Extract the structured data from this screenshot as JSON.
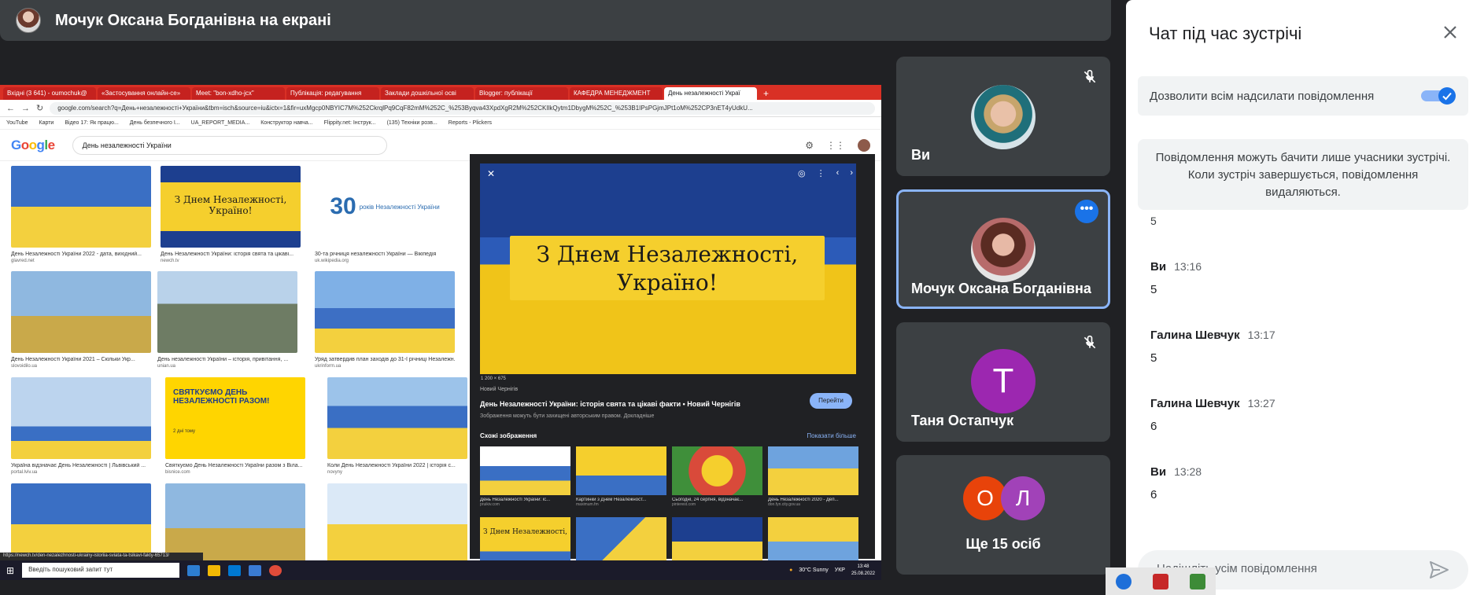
{
  "presenter": {
    "title": "Мочук Оксана Богданівна на екрані"
  },
  "screen": {
    "tabs": [
      "Вхідні (3 641) - oumochuk@",
      "«Застосування онлайн-се»",
      "Meet: \"bon-xdho-jcx\"",
      "Публікація: редагування",
      "Заклади дошкільної осві",
      "Blogger: публікації",
      "КАФЕДРА МЕНЕДЖМЕНТ",
      "День незалежності Украї"
    ],
    "url": "google.com/search?q=День+незалежності+України&tbm=isch&source=iu&ictx=1&fir=uxMgcp0NBYIC7M%252CkrqlPq9CqF82mM%252C_%253Byqva43XpdXgR2M%252CKIlkQytm1DbygM%252C_%253B1IPsPGjmJPt1oM%252CP3nET4yUdkU...",
    "bookmarks": [
      "YouTube",
      "Карти",
      "Відео 17: Як працю...",
      "День безпечного І...",
      "UA_REPORT_MEDIA...",
      "Конструктор навча...",
      "Flippity.net: Інструк...",
      "(135) Техніки розв...",
      "Reports - Plickers"
    ],
    "search_query": "День незалежності України",
    "results": [
      {
        "caption": "День Незалежності України 2022 - дата, вихідний...",
        "source": "glavred.net"
      },
      {
        "caption": "День Незалежності України: історія свята та цікаві...",
        "source": "newch.tv",
        "image_text": "З Днем Незалежності, Україно!"
      },
      {
        "caption": "30-та річниця незалежності України — Вікіпедія",
        "source": "uk.wikipedia.org",
        "logo_number": "30",
        "logo_text": "років Незалежності України"
      },
      {
        "caption": "День Незалежності України 2021 – Скільки Укр...",
        "source": "slovoidilo.ua"
      },
      {
        "caption": "День незалежності України – історія, привітання, ...",
        "source": "unian.ua"
      },
      {
        "caption": "Уряд затвердив план заходів до 31-ї річниці Незалежн...",
        "source": "ukrinform.ua"
      },
      {
        "caption": "Україна відзначає День Незалежності | Львівський ...",
        "source": "portal.lviv.ua"
      },
      {
        "caption": "Святкуємо День Незалежності України разом з Віла...",
        "source": "bisnice.com",
        "image_text": "СВЯТКУЄМО ДЕНЬ НЕЗАЛЕЖНОСТІ РАЗОМ!",
        "badge": "2 дні тому"
      },
      {
        "caption": "Коли День Незалежності України 2022 | історія с...",
        "source": "novyny"
      }
    ],
    "preview": {
      "banner_line1": "З Днем Незалежності,",
      "banner_line2": "Україно!",
      "dimensions": "1 200 × 675",
      "source": "Новий Чернігів",
      "title": "День Незалежності України: історія свята та цікаві факти • Новий Чернігів",
      "note": "Зображення можуть бути захищені авторським правом. Докладніше",
      "visit": "Перейти",
      "similar": "Схожі зображення",
      "show_more": "Показати більше",
      "thumbs": [
        {
          "caption": "День Незалежності України: іс...",
          "source": "pruikiv.com"
        },
        {
          "caption": "Картинки з Днем Незалежност...",
          "source": "maximum.fm"
        },
        {
          "caption": "Сьогодні, 24 серпня, відзначає...",
          "source": "pinterest.com"
        },
        {
          "caption": "День Незалежності 2020 - Деп...",
          "source": "don.fyn.city.gov.ua"
        }
      ],
      "thumb_text": "З Днем Незалежності,"
    },
    "status_url": "https://newch.tv/den-nezalezhnosti-ukrainy-istoriia-sviata-ta-tsikavi-fakty-65713/",
    "taskbar": {
      "search": "Введіть пошуковий запит тут",
      "weather": "30°C Sunny",
      "lang": "УКР",
      "time": "13:48",
      "date": "25.08.2022"
    }
  },
  "tiles": [
    {
      "name": "Ви"
    },
    {
      "name": "Мочук Оксана Богданівна"
    },
    {
      "name": "Таня Остапчук",
      "initial": "T"
    },
    {
      "initials": [
        "О",
        "Л"
      ],
      "label": "Ще 15 осіб"
    }
  ],
  "chat": {
    "title": "Чат під час зустрічі",
    "allow_label": "Дозволити всім надсилати повідомлення",
    "notice": "Повідомлення можуть бачити лише учасники зустрічі. Коли зустріч завершується, повідомлення видаляються.",
    "stray": "5",
    "messages": [
      {
        "sender": "Ви",
        "time": "13:16",
        "text": "5"
      },
      {
        "sender": "Галина Шевчук",
        "time": "13:17",
        "text": "5"
      },
      {
        "sender": "Галина Шевчук",
        "time": "13:27",
        "text": "6"
      },
      {
        "sender": "Ви",
        "time": "13:28",
        "text": "6"
      }
    ],
    "placeholder": "Надішліть усім повідомлення"
  },
  "colors": {
    "accent": "#1a73e8",
    "tile_bg": "#3c4043",
    "avatar_t": "#9c27b0",
    "avatar_o": "#e8430a",
    "avatar_l": "#a142b8"
  }
}
